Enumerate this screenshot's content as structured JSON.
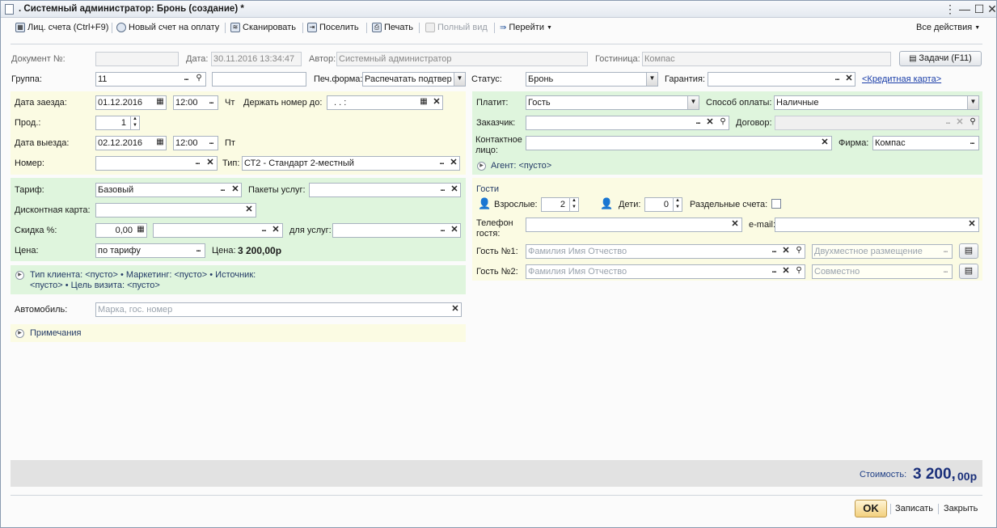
{
  "window": {
    "title": ". Системный администратор: Бронь (создание) *"
  },
  "toolbar": {
    "accounts": "Лиц. счета (Ctrl+F9)",
    "new_invoice": "Новый счет на оплату",
    "scan": "Сканировать",
    "check_in": "Поселить",
    "print": "Печать",
    "full_view": "Полный вид",
    "goto": "Перейти",
    "all_actions": "Все действия"
  },
  "header": {
    "doc_label": "Документ №:",
    "doc_value": "",
    "date_label": "Дата:",
    "date_value": "30.11.2016 13:34:47",
    "author_label": "Автор:",
    "author_value": "Системный администратор",
    "hotel_label": "Гостиница:",
    "hotel_value": "Компас",
    "tasks_button": "Задачи (F11)",
    "group_label": "Группа:",
    "group_value": "11",
    "group_extra_value": "",
    "print_form_label": "Печ.форма:",
    "print_form_value": "Распечатать подтвер",
    "status_label": "Статус:",
    "status_value": "Бронь",
    "guarantee_label": "Гарантия:",
    "guarantee_value": "",
    "credit_card_link": "<Кредитная карта>"
  },
  "stay": {
    "arrival_label": "Дата заезда:",
    "arrival_date": "01.12.2016",
    "arrival_time": "12:00",
    "arrival_day": "Чт",
    "hold_label": "Держать номер до:",
    "hold_value": ". .   :",
    "duration_label": "Прод.:",
    "duration_value": "1",
    "departure_label": "Дата выезда:",
    "departure_date": "02.12.2016",
    "departure_time": "12:00",
    "departure_day": "Пт",
    "room_label": "Номер:",
    "room_value": "",
    "type_label": "Тип:",
    "type_value": "СТ2 - Стандарт 2-местный"
  },
  "tariff": {
    "tariff_label": "Тариф:",
    "tariff_value": "Базовый",
    "packages_label": "Пакеты услуг:",
    "packages_value": "",
    "discount_card_label": "Дисконтная карта:",
    "discount_card_value": "",
    "discount_label": "Скидка %:",
    "discount_value": "0,00",
    "discount_reason": "",
    "for_services_label": "для услуг:",
    "for_services_value": "",
    "price_label": "Цена:",
    "price_mode": "по тарифу",
    "price_value_label": "Цена:",
    "price_value": "3 200,00р"
  },
  "marketing": {
    "line1": "Тип клиента: <пусто> • Маркетинг: <пусто> • Источник:",
    "line2": "<пусто> • Цель визита: <пусто>"
  },
  "car": {
    "label": "Автомобиль:",
    "placeholder": "Марка, гос. номер"
  },
  "notes": {
    "label": "Примечания"
  },
  "payer": {
    "pays_label": "Платит:",
    "pays_value": "Гость",
    "method_label": "Способ оплаты:",
    "method_value": "Наличные",
    "customer_label": "Заказчик:",
    "customer_value": "",
    "contract_label": "Договор:",
    "contract_value": "",
    "contact_label_1": "Контактное",
    "contact_label_2": "лицо:",
    "contact_value": "",
    "firm_label": "Фирма:",
    "firm_value": "Компас",
    "agent": "Агент: <пусто>"
  },
  "guests": {
    "title": "Гости",
    "adults_label": "Взрослые:",
    "adults_value": "2",
    "children_label": "Дети:",
    "children_value": "0",
    "separate_label": "Раздельные счета:",
    "phone_label_1": "Телефон",
    "phone_label_2": "гостя:",
    "phone_value": "",
    "email_label": "e-mail:",
    "email_value": "",
    "guest1_label": "Гость №1:",
    "guest1_placeholder": "Фамилия Имя Отчество",
    "guest1_accommodation": "Двухместное размещение",
    "guest2_label": "Гость №2:",
    "guest2_placeholder": "Фамилия Имя Отчество",
    "guest2_accommodation": "Совместно"
  },
  "footer": {
    "cost_label": "Стоимость:",
    "cost_main": "3 200,",
    "cost_cents": "00р",
    "ok": "OK",
    "save": "Записать",
    "close": "Закрыть"
  }
}
